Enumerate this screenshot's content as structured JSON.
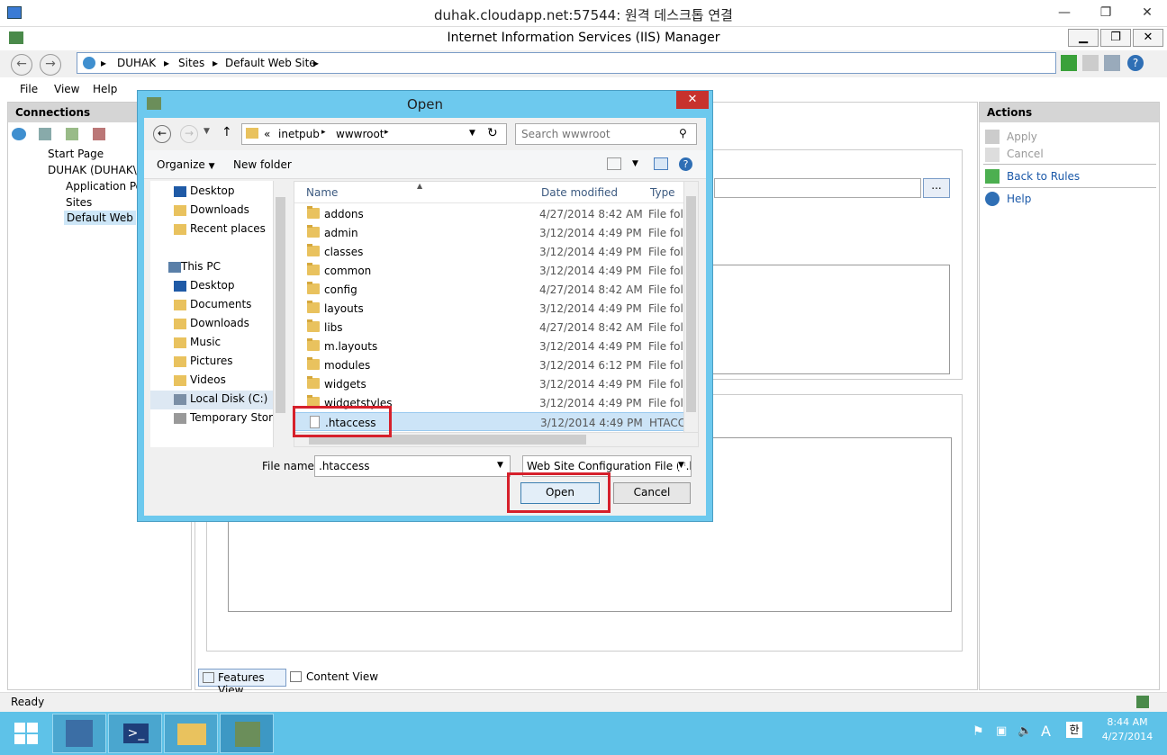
{
  "rdp": {
    "title": "duhak.cloudapp.net:57544: 원격 데스크톱 연결"
  },
  "iis": {
    "title": "Internet Information Services (IIS) Manager",
    "breadcrumbs": [
      "DUHAK",
      "Sites",
      "Default Web Site"
    ],
    "menu": [
      "File",
      "View",
      "Help"
    ]
  },
  "connections": {
    "header": "Connections",
    "tree": [
      "Start Page",
      "DUHAK (DUHAK\\a",
      "Application Poo",
      "Sites",
      "Default Web"
    ]
  },
  "actions": {
    "header": "Actions",
    "items": [
      {
        "label": "Apply",
        "enabled": false
      },
      {
        "label": "Cancel",
        "enabled": false
      },
      {
        "label": "Back to Rules",
        "enabled": true
      },
      {
        "label": "Help",
        "enabled": true
      }
    ]
  },
  "viewbar": {
    "features": "Features View",
    "content": "Content View"
  },
  "status": {
    "text": "Ready"
  },
  "taskbar": {
    "time": "8:44 AM",
    "date": "4/27/2014",
    "ime_a": "A",
    "ime_han": "한"
  },
  "dialog": {
    "title": "Open",
    "path": [
      "«",
      "inetpub",
      "wwwroot"
    ],
    "search_placeholder": "Search wwwroot",
    "organize": "Organize",
    "new_folder": "New folder",
    "nav": {
      "favorites": [
        "Desktop",
        "Downloads",
        "Recent places"
      ],
      "this_pc": "This PC",
      "pc_items": [
        "Desktop",
        "Documents",
        "Downloads",
        "Music",
        "Pictures",
        "Videos",
        "Local Disk (C:)",
        "Temporary Stora"
      ]
    },
    "columns": {
      "name": "Name",
      "date": "Date modified",
      "type": "Type"
    },
    "files": [
      {
        "name": "addons",
        "date": "4/27/2014 8:42 AM",
        "type": "File folde"
      },
      {
        "name": "admin",
        "date": "3/12/2014 4:49 PM",
        "type": "File folde"
      },
      {
        "name": "classes",
        "date": "3/12/2014 4:49 PM",
        "type": "File folde"
      },
      {
        "name": "common",
        "date": "3/12/2014 4:49 PM",
        "type": "File folde"
      },
      {
        "name": "config",
        "date": "4/27/2014 8:42 AM",
        "type": "File folde"
      },
      {
        "name": "layouts",
        "date": "3/12/2014 4:49 PM",
        "type": "File folde"
      },
      {
        "name": "libs",
        "date": "4/27/2014 8:42 AM",
        "type": "File folde"
      },
      {
        "name": "m.layouts",
        "date": "3/12/2014 4:49 PM",
        "type": "File folde"
      },
      {
        "name": "modules",
        "date": "3/12/2014 6:12 PM",
        "type": "File folde"
      },
      {
        "name": "widgets",
        "date": "3/12/2014 4:49 PM",
        "type": "File folde"
      },
      {
        "name": "widgetstyles",
        "date": "3/12/2014 4:49 PM",
        "type": "File folde"
      },
      {
        "name": ".htaccess",
        "date": "3/12/2014 4:49 PM",
        "type": "HTACCES"
      }
    ],
    "filename_label": "File name:",
    "filename_value": ".htaccess",
    "filter": "Web Site Configuration File (*.h",
    "open": "Open",
    "cancel": "Cancel"
  }
}
